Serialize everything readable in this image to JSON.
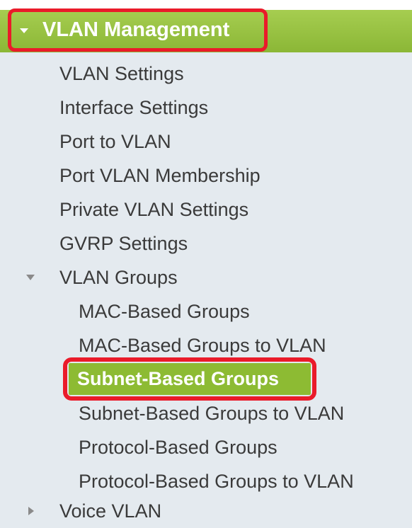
{
  "header": {
    "title": "VLAN Management"
  },
  "menu": {
    "vlan_settings": "VLAN Settings",
    "interface_settings": "Interface Settings",
    "port_to_vlan": "Port to VLAN",
    "port_vlan_membership": "Port VLAN Membership",
    "private_vlan_settings": "Private VLAN Settings",
    "gvrp_settings": "GVRP Settings",
    "vlan_groups": {
      "label": "VLAN Groups",
      "children": {
        "mac_based_groups": "MAC-Based Groups",
        "mac_based_groups_to_vlan": "MAC-Based Groups to VLAN",
        "subnet_based_groups": "Subnet-Based Groups",
        "subnet_based_groups_to_vlan": "Subnet-Based Groups to VLAN",
        "protocol_based_groups": "Protocol-Based Groups",
        "protocol_based_groups_to_vlan": "Protocol-Based Groups to VLAN"
      }
    },
    "voice_vlan": "Voice VLAN"
  },
  "colors": {
    "header_green": "#8bb736",
    "selected_green": "#8dbb33",
    "highlight_red": "#ea1b2a",
    "panel_bg": "#e4eaef"
  },
  "icons": {
    "header_expand": "caret-down-icon",
    "vlan_groups_expand": "caret-down-icon",
    "voice_vlan_collapse": "caret-right-icon"
  }
}
